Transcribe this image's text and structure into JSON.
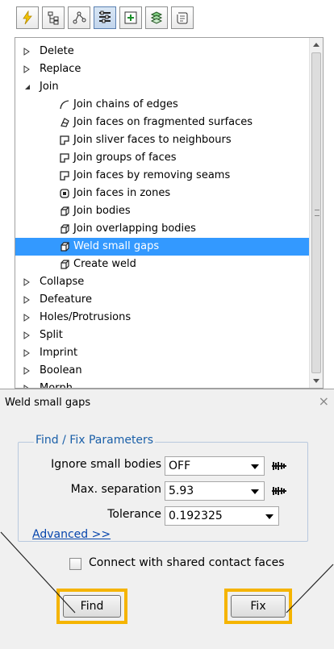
{
  "toolbar": {
    "tabs": [
      {
        "icon": "lightning-icon"
      },
      {
        "icon": "hierarchy-icon"
      },
      {
        "icon": "network-icon"
      },
      {
        "icon": "settings-list-icon"
      },
      {
        "icon": "add-frame-icon"
      },
      {
        "icon": "layers-icon"
      },
      {
        "icon": "script-icon"
      }
    ]
  },
  "tree": {
    "categories_top": [
      {
        "label": "Delete"
      },
      {
        "label": "Replace"
      },
      {
        "label": "Join"
      }
    ],
    "join_children": [
      {
        "label": "Join chains of edges",
        "icon": "edge-chain-icon"
      },
      {
        "label": "Join faces on fragmented surfaces",
        "icon": "fragment-faces-icon"
      },
      {
        "label": "Join sliver faces to neighbours",
        "icon": "face-join-icon"
      },
      {
        "label": "Join groups of faces",
        "icon": "face-join-icon"
      },
      {
        "label": "Join faces by removing seams",
        "icon": "face-join-icon"
      },
      {
        "label": "Join faces in zones",
        "icon": "zone-faces-icon"
      },
      {
        "label": "Join bodies",
        "icon": "body-icon"
      },
      {
        "label": "Join overlapping bodies",
        "icon": "body-icon"
      },
      {
        "label": "Weld small gaps",
        "icon": "body-icon",
        "selected": true
      },
      {
        "label": "Create weld",
        "icon": "body-icon"
      }
    ],
    "categories_bottom": [
      {
        "label": "Collapse"
      },
      {
        "label": "Defeature"
      },
      {
        "label": "Holes/Protrusions"
      },
      {
        "label": "Split"
      },
      {
        "label": "Imprint"
      },
      {
        "label": "Boolean"
      },
      {
        "label": "Morph"
      }
    ]
  },
  "panel": {
    "title": "Weld small gaps",
    "close": "×",
    "group_title": "Find / Fix Parameters",
    "ignore_label": "Ignore small bodies",
    "ignore_value": "OFF",
    "maxsep_label": "Max. separation",
    "maxsep_value": "5.93",
    "tol_label": "Tolerance",
    "tol_value": "0.192325",
    "advanced": "Advanced >>",
    "connect_label": "Connect with shared contact faces",
    "find": "Find",
    "fix": "Fix"
  },
  "colors": {
    "selection": "#3399ff",
    "highlight": "#f5b400",
    "group_title": "#1a5fa8",
    "link": "#0645ad"
  }
}
